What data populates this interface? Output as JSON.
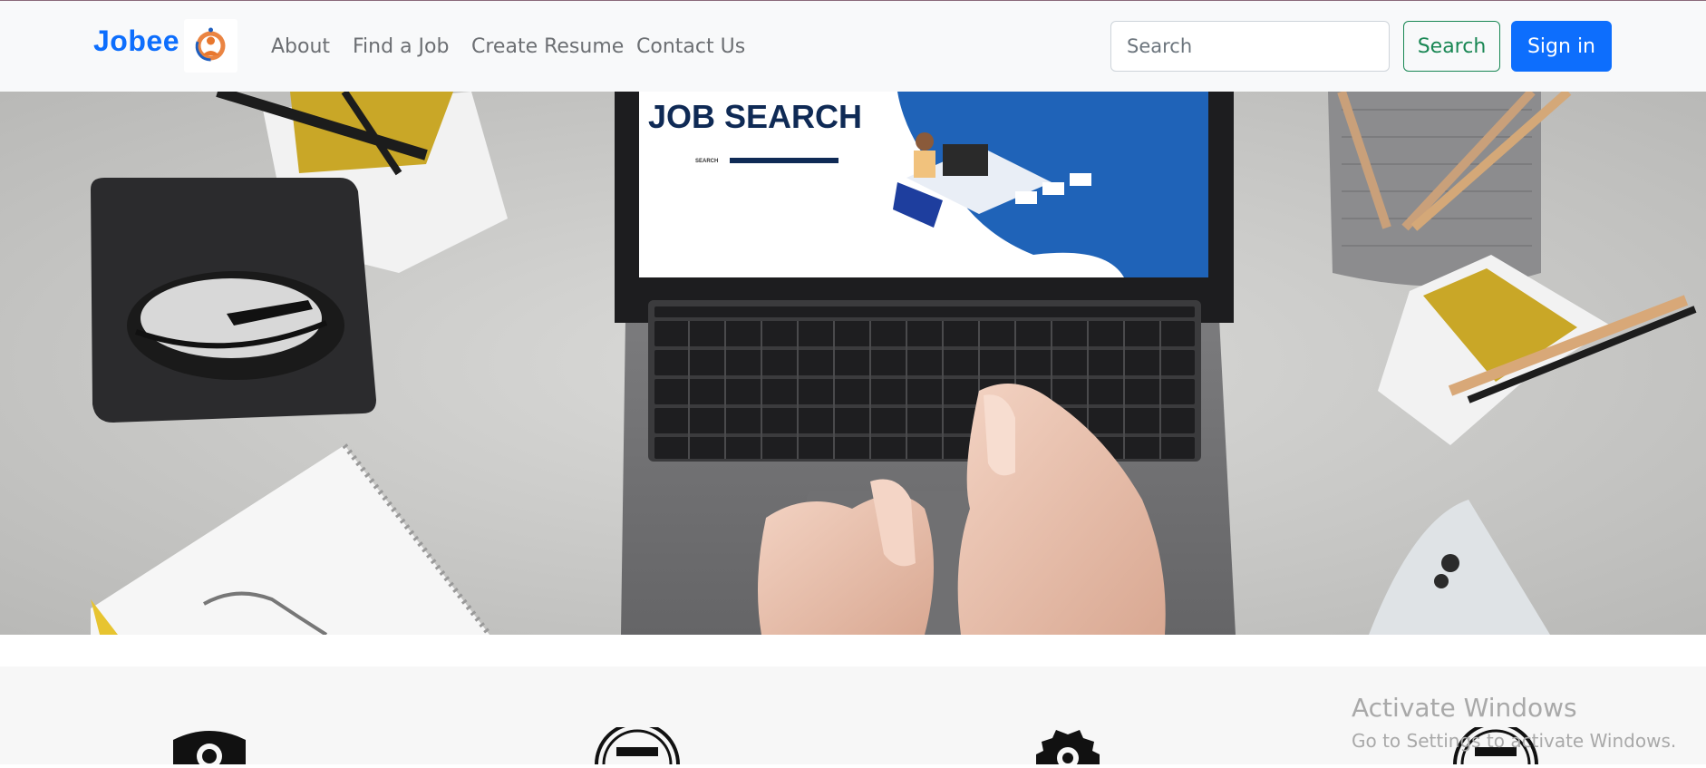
{
  "brand": {
    "name": "Jobee"
  },
  "nav": {
    "links": [
      {
        "label": "About"
      },
      {
        "label": "Find a Job"
      },
      {
        "label": "Create Resume"
      },
      {
        "label": "Contact Us"
      }
    ]
  },
  "search": {
    "placeholder": "Search",
    "button_label": "Search"
  },
  "auth": {
    "signin_label": "Sign in"
  },
  "hero": {
    "screen_title": "JOB SEARCH",
    "screen_search_label": "SEARCH"
  },
  "features": {
    "icons": [
      "badge-icon",
      "circle-badge-icon",
      "gear-icon",
      "circle-badge-icon"
    ]
  },
  "watermark": {
    "title": "Activate Windows",
    "subtitle": "Go to Settings to activate Windows."
  },
  "colors": {
    "brand_blue": "#0d6efd",
    "success_green": "#198754",
    "navbar_bg": "#f8f9fa"
  }
}
